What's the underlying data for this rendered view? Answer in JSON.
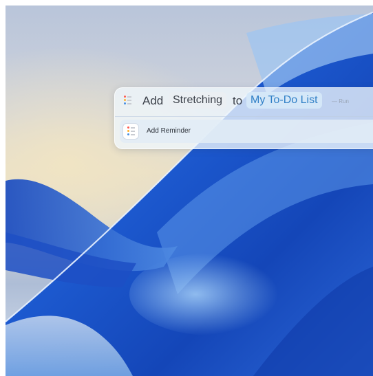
{
  "shortcut": {
    "word_add": "Add",
    "item_token": "Stretching",
    "word_to": "to",
    "list_token": "My To-Do List",
    "run_label": "— Run",
    "action_label": "Add Reminder",
    "icon": "reminders-list-icon"
  },
  "colors": {
    "accent_text": "#2f7fc6",
    "accent_bg": "#d5e8f8",
    "wallpaper_blue": "#1a55c8"
  }
}
